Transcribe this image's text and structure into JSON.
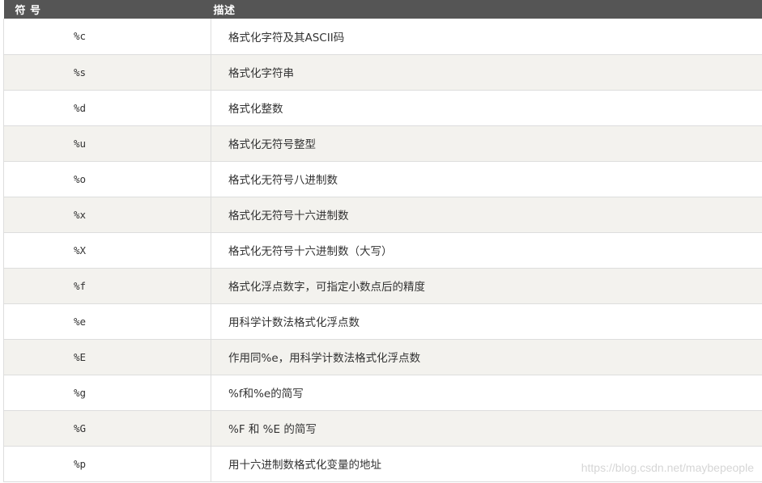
{
  "header": {
    "col_symbol": "符 号",
    "col_desc": "描述"
  },
  "rows": [
    {
      "symbol": "%c",
      "desc": "格式化字符及其ASCII码"
    },
    {
      "symbol": "%s",
      "desc": "格式化字符串"
    },
    {
      "symbol": "%d",
      "desc": "格式化整数"
    },
    {
      "symbol": "%u",
      "desc": "格式化无符号整型"
    },
    {
      "symbol": "%o",
      "desc": "格式化无符号八进制数"
    },
    {
      "symbol": "%x",
      "desc": "格式化无符号十六进制数"
    },
    {
      "symbol": "%X",
      "desc": "格式化无符号十六进制数（大写）"
    },
    {
      "symbol": "%f",
      "desc": "格式化浮点数字，可指定小数点后的精度"
    },
    {
      "symbol": "%e",
      "desc": "用科学计数法格式化浮点数"
    },
    {
      "symbol": "%E",
      "desc": "作用同%e，用科学计数法格式化浮点数"
    },
    {
      "symbol": "%g",
      "desc": "%f和%e的简写"
    },
    {
      "symbol": "%G",
      "desc": "%F 和 %E 的简写"
    },
    {
      "symbol": "%p",
      "desc": "用十六进制数格式化变量的地址"
    }
  ],
  "watermark": "https://blog.csdn.net/maybepeople"
}
